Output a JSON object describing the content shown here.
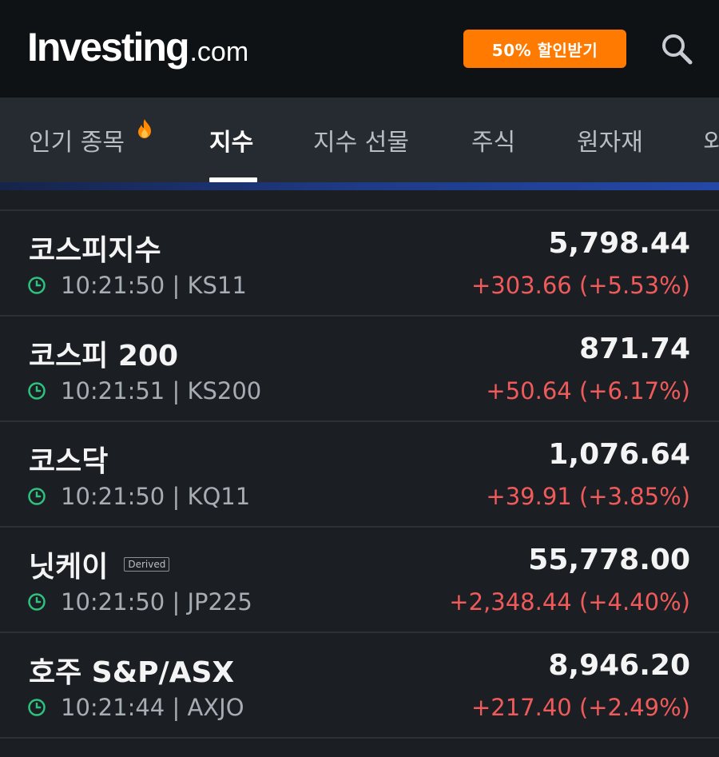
{
  "header": {
    "logo_main": "Investing",
    "logo_suffix": ".com",
    "promo_label": "50% 할인받기",
    "search_icon": "search-icon"
  },
  "tabs": [
    {
      "label": "인기 종목",
      "icon": "fire-icon",
      "active": false
    },
    {
      "label": "지수",
      "active": true
    },
    {
      "label": "지수 선물",
      "active": false
    },
    {
      "label": "주식",
      "active": false
    },
    {
      "label": "원자재",
      "active": false
    },
    {
      "label": "외",
      "active": false
    }
  ],
  "colors": {
    "accent_orange": "#ff7a00",
    "positive_change": "#f05a5a",
    "clock_green": "#2ec27e",
    "background": "#1b1f24"
  },
  "indices": [
    {
      "name": "코스피지수",
      "time": "10:21:50",
      "symbol": "KS11",
      "price": "5,798.44",
      "change": "+303.66 (+5.53%)"
    },
    {
      "name": "코스피 200",
      "time": "10:21:51",
      "symbol": "KS200",
      "price": "871.74",
      "change": "+50.64 (+6.17%)"
    },
    {
      "name": "코스닥",
      "time": "10:21:50",
      "symbol": "KQ11",
      "price": "1,076.64",
      "change": "+39.91 (+3.85%)"
    },
    {
      "name": "닛케이",
      "badge": "Derived",
      "time": "10:21:50",
      "symbol": "JP225",
      "price": "55,778.00",
      "change": "+2,348.44 (+4.40%)"
    },
    {
      "name": "호주 S&P/ASX",
      "time": "10:21:44",
      "symbol": "AXJO",
      "price": "8,946.20",
      "change": "+217.40 (+2.49%)"
    }
  ]
}
